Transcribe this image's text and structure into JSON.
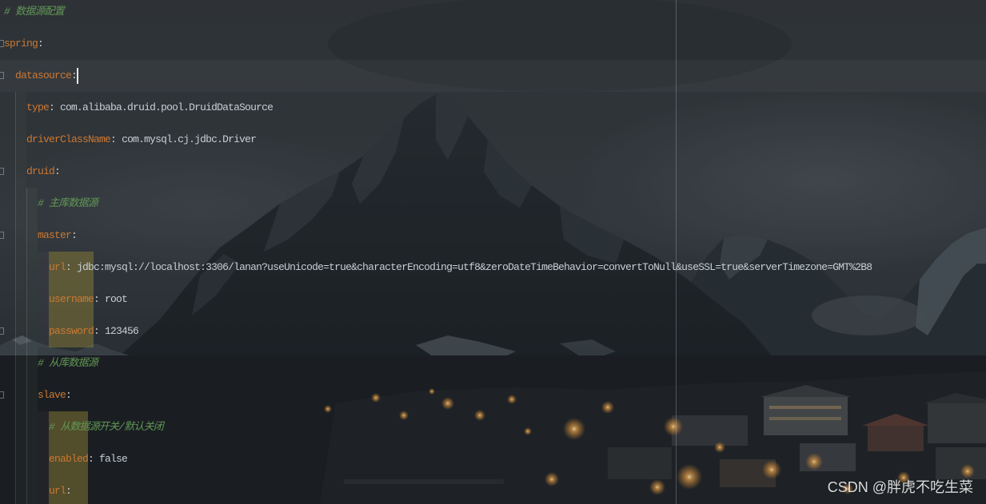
{
  "editor": {
    "language": "YAML",
    "lines": [
      {
        "comment": "# 数据源配置"
      },
      {
        "key": "spring",
        "colon": ":"
      },
      {
        "key": "datasource",
        "colon": ":"
      },
      {
        "key": "type",
        "colon": ":",
        "value": "com.alibaba.druid.pool.DruidDataSource"
      },
      {
        "key": "driverClassName",
        "colon": ":",
        "value": "com.mysql.cj.jdbc.Driver"
      },
      {
        "key": "druid",
        "colon": ":"
      },
      {
        "comment": "# 主库数据源"
      },
      {
        "key": "master",
        "colon": ":"
      },
      {
        "key": "url",
        "colon": ":",
        "value": "jdbc:mysql://localhost:3306/lanan?useUnicode=true&characterEncoding=utf8&zeroDateTimeBehavior=convertToNull&useSSL=true&serverTimezone=GMT%2B8"
      },
      {
        "key": "username",
        "colon": ":",
        "value": "root"
      },
      {
        "key": "password",
        "colon": ":",
        "value": "123456"
      },
      {
        "comment": "# 从库数据源"
      },
      {
        "key": "slave",
        "colon": ":"
      },
      {
        "comment": "# 从数据源开关/默认关闭"
      },
      {
        "key": "enabled",
        "colon": ":",
        "value": "false"
      },
      {
        "key": "url",
        "colon": ":"
      }
    ]
  },
  "icons": [
    "fold-marker-icon"
  ],
  "watermark": {
    "text": "CSDN @胖虎不吃生菜"
  },
  "theme": {
    "key_color": "#cc7832",
    "value_color": "#c6cfd6",
    "comment_color": "#629755",
    "caret_color": "#e6e6e6",
    "highlight_color": "#968737"
  }
}
